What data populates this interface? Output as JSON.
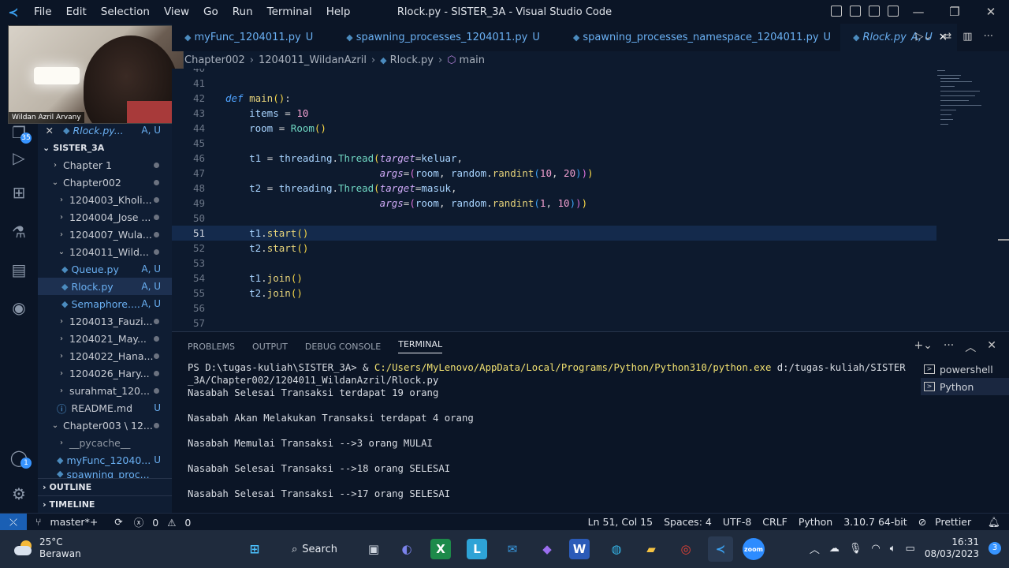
{
  "titlebar": {
    "menu": [
      "File",
      "Edit",
      "Selection",
      "View",
      "Go",
      "Run",
      "Terminal",
      "Help"
    ],
    "title": "Rlock.py - SISTER_3A - Visual Studio Code"
  },
  "webcam": {
    "name": "Wildan Azril Arvany"
  },
  "activity_badges": {
    "explorer": "35",
    "accounts": "1"
  },
  "open_editor": {
    "label": "Rlock.py...",
    "status": "A, U"
  },
  "explorer": {
    "root": "SISTER_3A",
    "items": [
      {
        "label": "Chapter 1",
        "status": ""
      },
      {
        "label": "Chapter002",
        "status": ""
      },
      {
        "label": "1204003_Kholi...",
        "status": ""
      },
      {
        "label": "1204004_Jose ...",
        "status": ""
      },
      {
        "label": "1204007_Wula...",
        "status": ""
      },
      {
        "label": "1204011_Wild...",
        "status": ""
      },
      {
        "label": "Queue.py",
        "status": "A, U"
      },
      {
        "label": "Rlock.py",
        "status": "A, U"
      },
      {
        "label": "Semaphore....",
        "status": "A, U"
      },
      {
        "label": "1204013_Fauzi...",
        "status": ""
      },
      {
        "label": "1204021_May...",
        "status": ""
      },
      {
        "label": "1204022_Hana...",
        "status": ""
      },
      {
        "label": "1204026_Hary...",
        "status": ""
      },
      {
        "label": "surahmat_120...",
        "status": ""
      },
      {
        "label": "README.md",
        "status": "U"
      },
      {
        "label": "Chapter003 \\ 12...",
        "status": ""
      },
      {
        "label": "__pycache__",
        "status": ""
      },
      {
        "label": "myFunc_12040...",
        "status": "U"
      },
      {
        "label": "spawning_proc...",
        "status": ""
      }
    ],
    "outline": "OUTLINE",
    "timeline": "TIMELINE"
  },
  "tabs": [
    {
      "label": "myFunc_1204011.py",
      "status": "U"
    },
    {
      "label": "spawning_processes_1204011.py",
      "status": "U"
    },
    {
      "label": "spawning_processes_namespace_1204011.py",
      "status": "U"
    },
    {
      "label": "Rlock.py",
      "status": "A, U"
    }
  ],
  "breadcrumb": [
    "Chapter002",
    "1204011_WildanAzril",
    "Rlock.py",
    "main"
  ],
  "code_lines": [
    "40",
    "41",
    "42",
    "43",
    "44",
    "45",
    "46",
    "47",
    "48",
    "49",
    "50",
    "51",
    "52",
    "53",
    "54",
    "55",
    "56",
    "57"
  ],
  "panel": {
    "tabs": [
      "PROBLEMS",
      "OUTPUT",
      "DEBUG CONSOLE",
      "TERMINAL"
    ],
    "terminal": {
      "prompt": "PS D:\\tugas-kuliah\\SISTER_3A> & ",
      "exe": "C:/Users/MyLenovo/AppData/Local/Programs/Python/Python310/python.exe",
      "arg1": " d:/tugas-kuliah/SISTER",
      "arg2": "_3A/Chapter002/1204011_WildanAzril/Rlock.py",
      "out": [
        "Nasabah Selesai Transaksi terdapat 19 orang",
        "Nasabah Akan Melakukan Transaksi terdapat 4 orang",
        "Nasabah Memulai Transaksi -->3 orang MULAI",
        "Nasabah Selesai Transaksi -->18 orang SELESAI",
        "Nasabah Selesai Transaksi -->17 orang SELESAI"
      ]
    },
    "terminal_list": [
      "powershell",
      "Python"
    ]
  },
  "statusbar": {
    "branch": "master*+",
    "errors": "0",
    "warnings": "0",
    "position": "Ln 51, Col 15",
    "spaces": "Spaces: 4",
    "encoding": "UTF-8",
    "eol": "CRLF",
    "language": "Python",
    "interpreter": "3.10.7 64-bit",
    "formatter": "Prettier"
  },
  "taskbar": {
    "temp": "25°C",
    "weather": "Berawan",
    "search": "Search",
    "time": "16:31",
    "date": "08/03/2023",
    "notifications": "3"
  }
}
